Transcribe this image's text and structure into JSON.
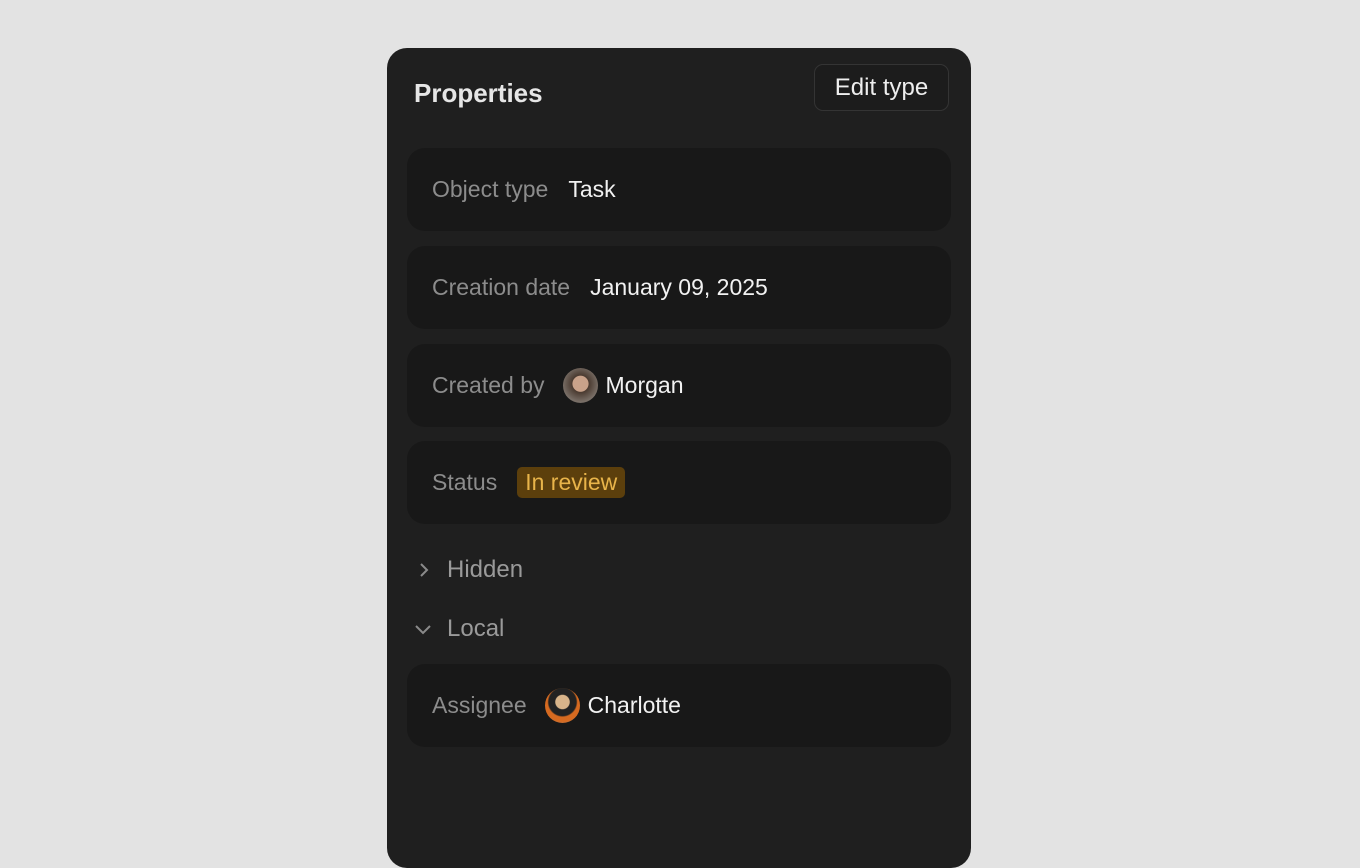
{
  "panel": {
    "title": "Properties",
    "edit_button": "Edit type"
  },
  "properties": [
    {
      "label": "Object type",
      "value": "Task"
    },
    {
      "label": "Creation date",
      "value": "January 09, 2025"
    },
    {
      "label": "Created by",
      "value": "Morgan"
    },
    {
      "label": "Status",
      "value": "In review"
    }
  ],
  "status_colors": {
    "badge_bg": "#5c3f0c",
    "badge_text": "#e8b44a"
  },
  "sections": {
    "hidden": {
      "label": "Hidden",
      "expanded": false
    },
    "local": {
      "label": "Local",
      "expanded": true
    }
  },
  "local_properties": [
    {
      "label": "Assignee",
      "value": "Charlotte"
    }
  ]
}
